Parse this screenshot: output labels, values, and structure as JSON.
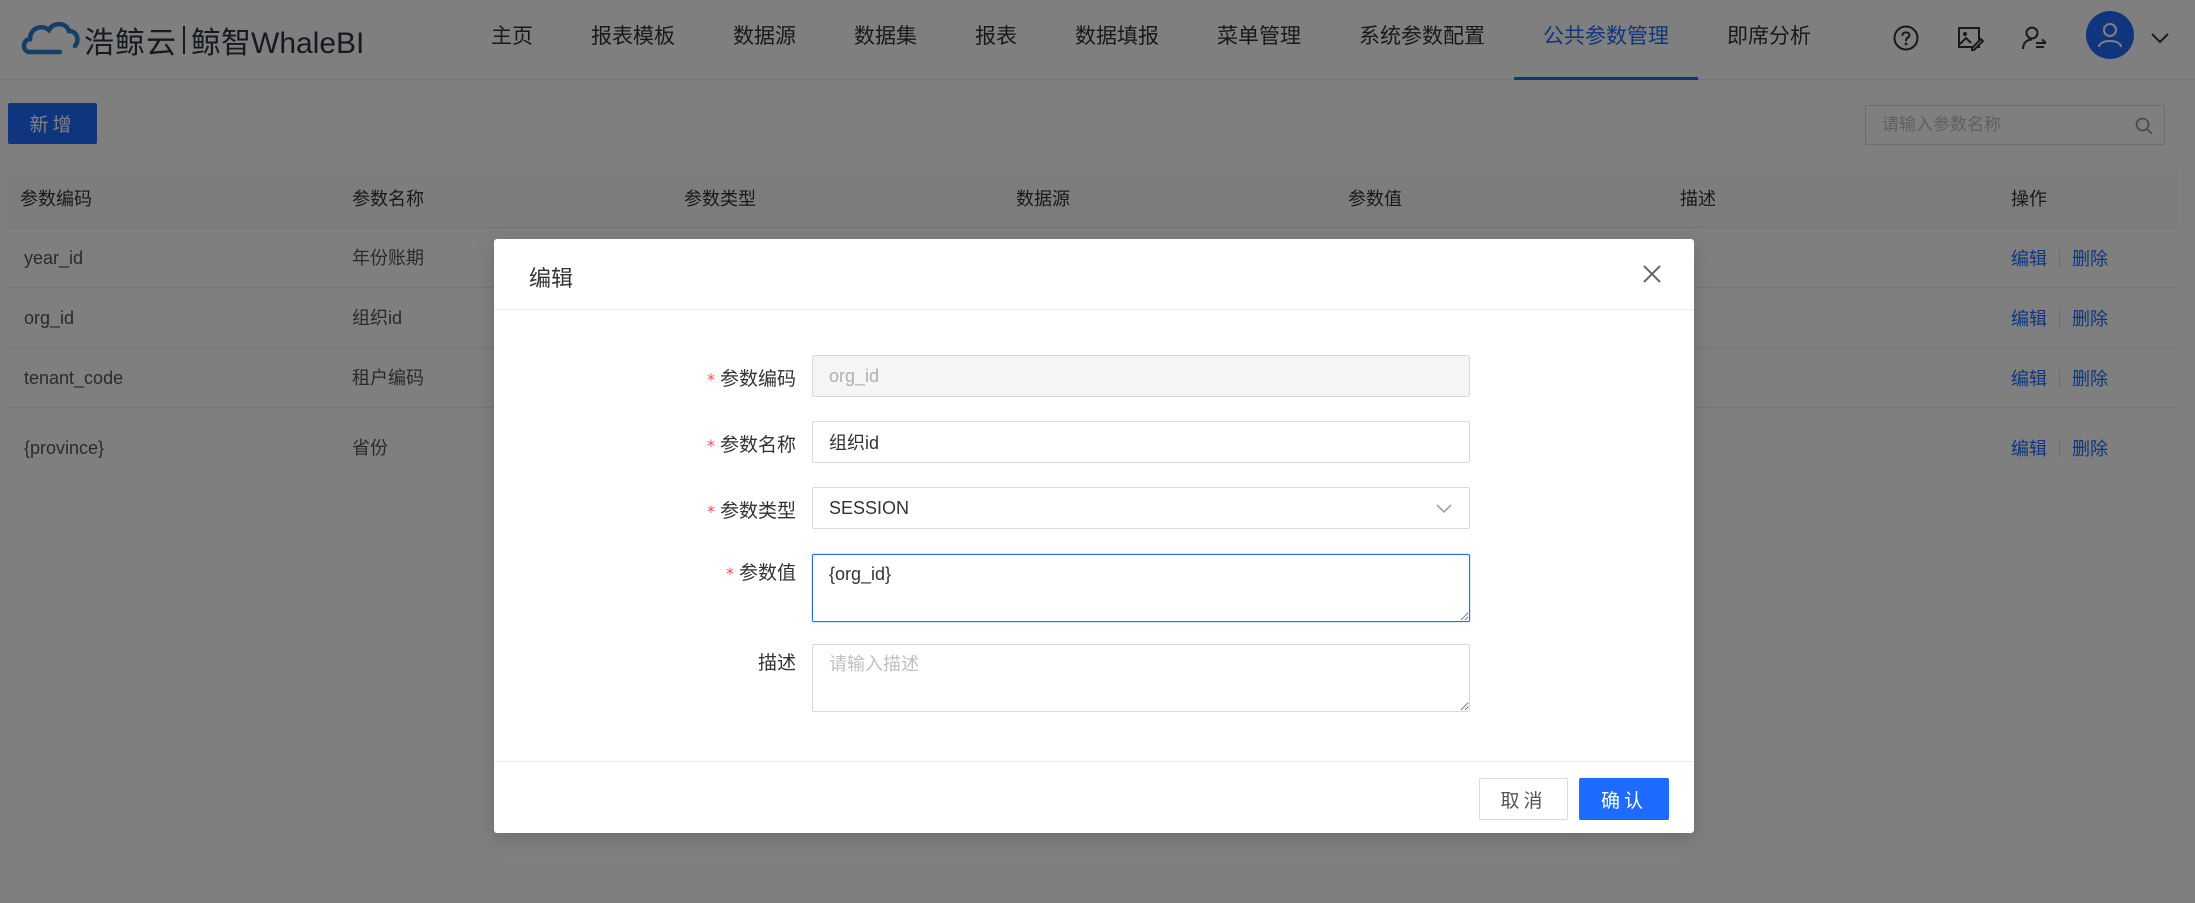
{
  "brand": {
    "name": "浩鲸云",
    "product": "鲸智WhaleBI",
    "color": "#2a7ec8"
  },
  "nav": {
    "items": [
      {
        "label": "主页",
        "active": false
      },
      {
        "label": "报表模板",
        "active": false
      },
      {
        "label": "数据源",
        "active": false
      },
      {
        "label": "数据集",
        "active": false
      },
      {
        "label": "报表",
        "active": false
      },
      {
        "label": "数据填报",
        "active": false
      },
      {
        "label": "菜单管理",
        "active": false
      },
      {
        "label": "系统参数配置",
        "active": false
      },
      {
        "label": "公共参数管理",
        "active": true
      },
      {
        "label": "即席分析",
        "active": false
      }
    ],
    "tools": [
      "help-icon",
      "image-edit-icon",
      "user-switch-icon"
    ],
    "accent": "#1f6bff"
  },
  "toolbar": {
    "add_label": "新增",
    "search_placeholder": "请输入参数名称"
  },
  "table": {
    "columns": [
      "参数编码",
      "参数名称",
      "参数类型",
      "数据源",
      "参数值",
      "描述",
      "操作"
    ],
    "rows": [
      {
        "code": "year_id",
        "name": "年份账期"
      },
      {
        "code": "org_id",
        "name": "组织id"
      },
      {
        "code": "tenant_code",
        "name": "租户编码"
      },
      {
        "code": "{province}",
        "name": "省份"
      }
    ],
    "edit_label": "编辑",
    "delete_label": "删除"
  },
  "modal": {
    "title": "编辑",
    "fields": {
      "code": {
        "label": "参数编码",
        "value": "org_id",
        "required": true,
        "disabled": true
      },
      "name": {
        "label": "参数名称",
        "value": "组织id",
        "required": true
      },
      "type": {
        "label": "参数类型",
        "value": "SESSION",
        "required": true
      },
      "value": {
        "label": "参数值",
        "value": "{org_id}",
        "required": true
      },
      "desc": {
        "label": "描述",
        "placeholder": "请输入描述",
        "required": false
      }
    },
    "required_mark": "*",
    "cancel_label": "取消",
    "confirm_label": "确认"
  }
}
